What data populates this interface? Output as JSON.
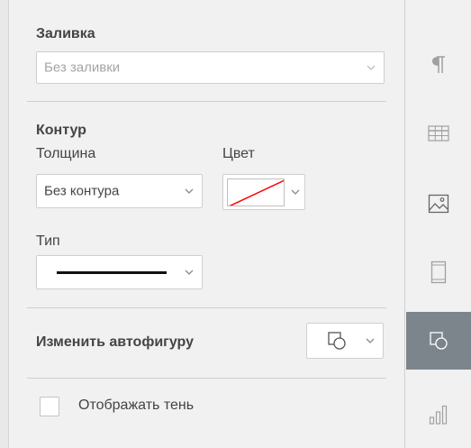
{
  "fill": {
    "title": "Заливка",
    "value": "Без заливки"
  },
  "stroke": {
    "title": "Контур",
    "width_label": "Толщина",
    "width_value": "Без контура",
    "color_label": "Цвет",
    "type_label": "Тип"
  },
  "shape": {
    "change_label": "Изменить автофигуру"
  },
  "shadow": {
    "label": "Отображать тень",
    "checked": false
  },
  "right_toolbar": {
    "items": [
      {
        "icon": "paragraph-icon",
        "active": false
      },
      {
        "icon": "table-icon",
        "active": false
      },
      {
        "icon": "image-icon",
        "active": false
      },
      {
        "icon": "header-footer-icon",
        "active": false
      },
      {
        "icon": "shape-icon",
        "active": true
      },
      {
        "icon": "chart-icon",
        "active": false
      }
    ]
  },
  "colors": {
    "active_button": "#7d858c",
    "swatch_line": "#ff0000"
  }
}
